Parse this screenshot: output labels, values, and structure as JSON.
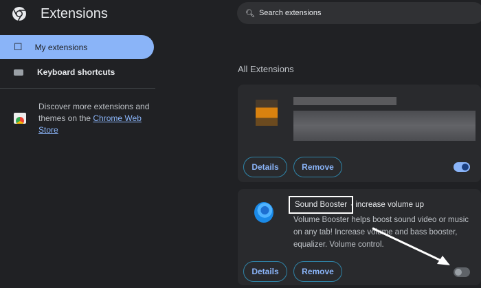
{
  "header": {
    "title": "Extensions",
    "search_placeholder": "Search extensions"
  },
  "sidebar": {
    "items": [
      {
        "label": "My extensions",
        "active": true
      },
      {
        "label": "Keyboard shortcuts"
      }
    ],
    "discover_text": "Discover more extensions and themes on the ",
    "discover_link": "Chrome Web Store"
  },
  "main": {
    "heading": "All Extensions",
    "extensions": [
      {
        "name": "",
        "description": "",
        "details_label": "Details",
        "remove_label": "Remove",
        "enabled": true
      },
      {
        "name": "Sound Booster",
        "name_suffix": " - increase volume up",
        "description": "Volume Booster helps boost sound video or music on any tab! Increase volume and bass booster, equalizer. Volume control.",
        "details_label": "Details",
        "remove_label": "Remove",
        "enabled": false
      }
    ]
  },
  "colors": {
    "accent": "#8ab4f8",
    "background": "#202124",
    "card": "#292a2d"
  }
}
